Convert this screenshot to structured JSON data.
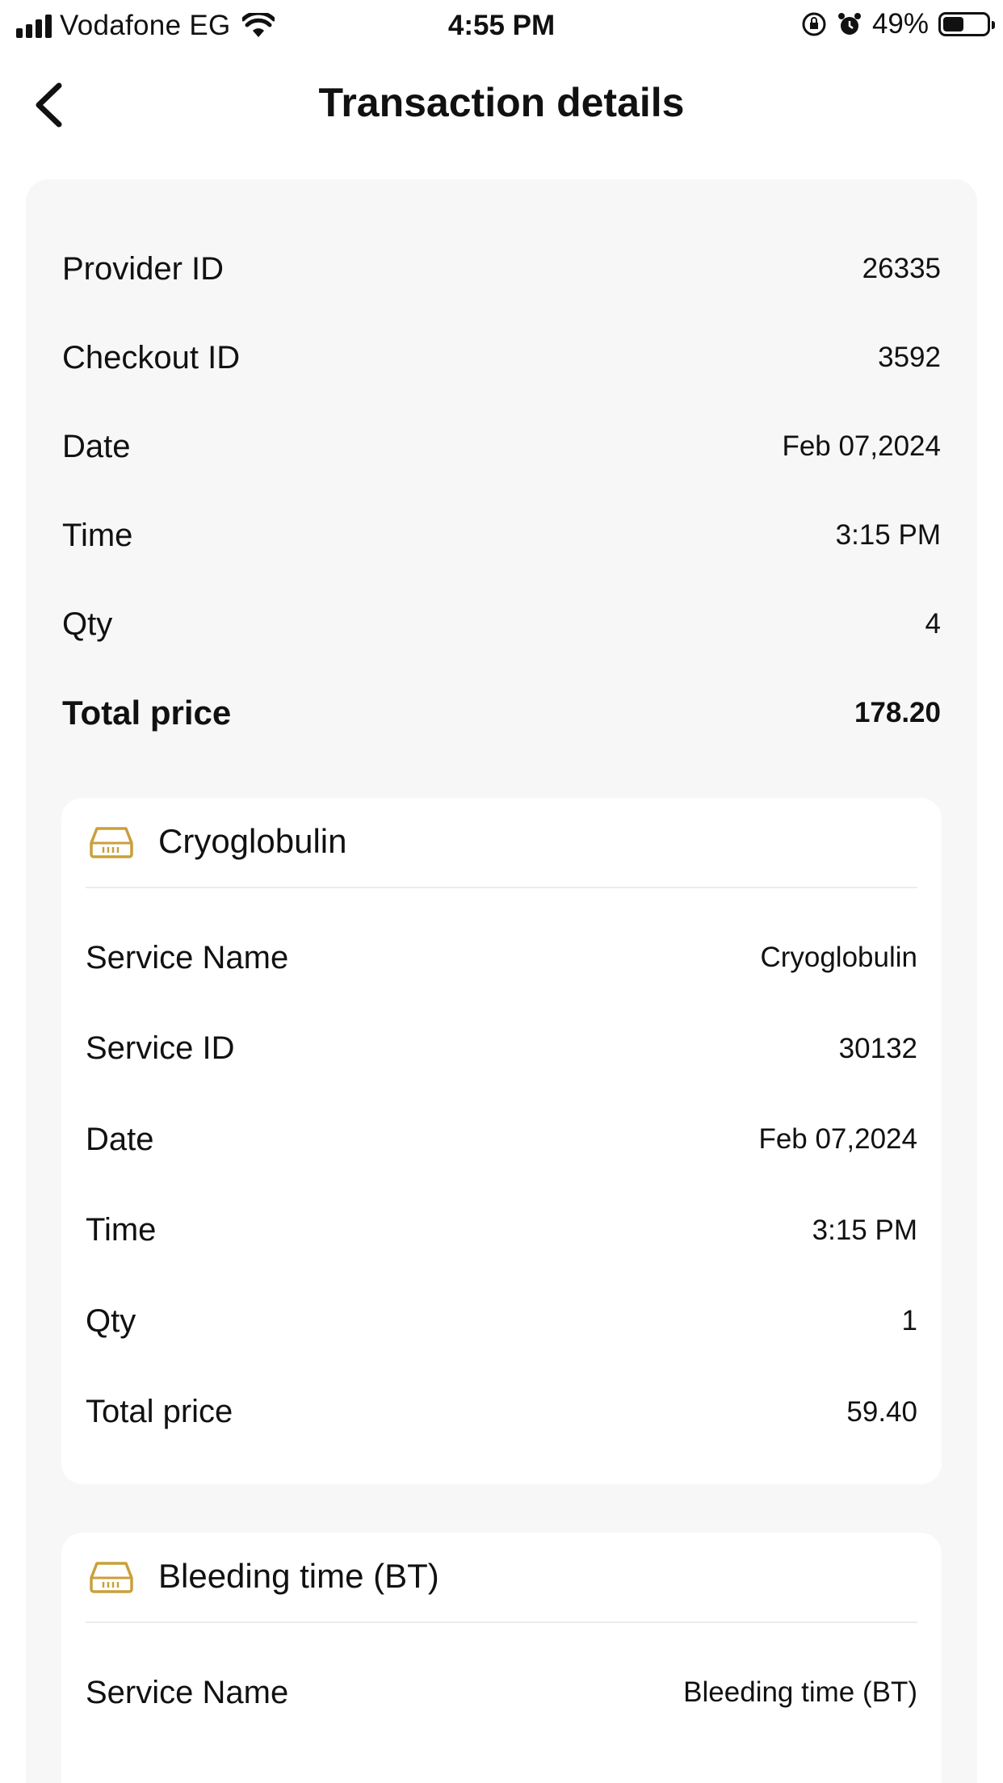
{
  "status_bar": {
    "carrier": "Vodafone EG",
    "time": "4:55 PM",
    "battery_percent": "49%",
    "battery_level": 0.49,
    "icons": [
      "signal-icon",
      "wifi-icon",
      "rotation-lock-icon",
      "alarm-icon",
      "battery-icon"
    ]
  },
  "header": {
    "title": "Transaction details",
    "back_icon": "chevron-left-icon"
  },
  "summary": {
    "provider_id": {
      "label": "Provider ID",
      "value": "26335"
    },
    "checkout_id": {
      "label": "Checkout ID",
      "value": "3592"
    },
    "date": {
      "label": "Date",
      "value": "Feb 07,2024"
    },
    "time": {
      "label": "Time",
      "value": "3:15 PM"
    },
    "qty": {
      "label": "Qty",
      "value": "4"
    },
    "total_price": {
      "label": "Total price",
      "value": "178.20"
    }
  },
  "services": [
    {
      "title": "Cryoglobulin",
      "icon": "test-tube-rack-icon",
      "rows": [
        {
          "label": "Service Name",
          "value": "Cryoglobulin"
        },
        {
          "label": "Service ID",
          "value": "30132"
        },
        {
          "label": "Date",
          "value": "Feb 07,2024"
        },
        {
          "label": "Time",
          "value": "3:15 PM"
        },
        {
          "label": "Qty",
          "value": "1"
        },
        {
          "label": "Total price",
          "value": "59.40"
        }
      ]
    },
    {
      "title": "Bleeding time (BT)",
      "icon": "test-tube-rack-icon",
      "rows": [
        {
          "label": "Service Name",
          "value": "Bleeding time (BT)"
        }
      ]
    }
  ],
  "colors": {
    "accent_icon": "#c9a03a",
    "card_background": "#f7f7f7"
  }
}
